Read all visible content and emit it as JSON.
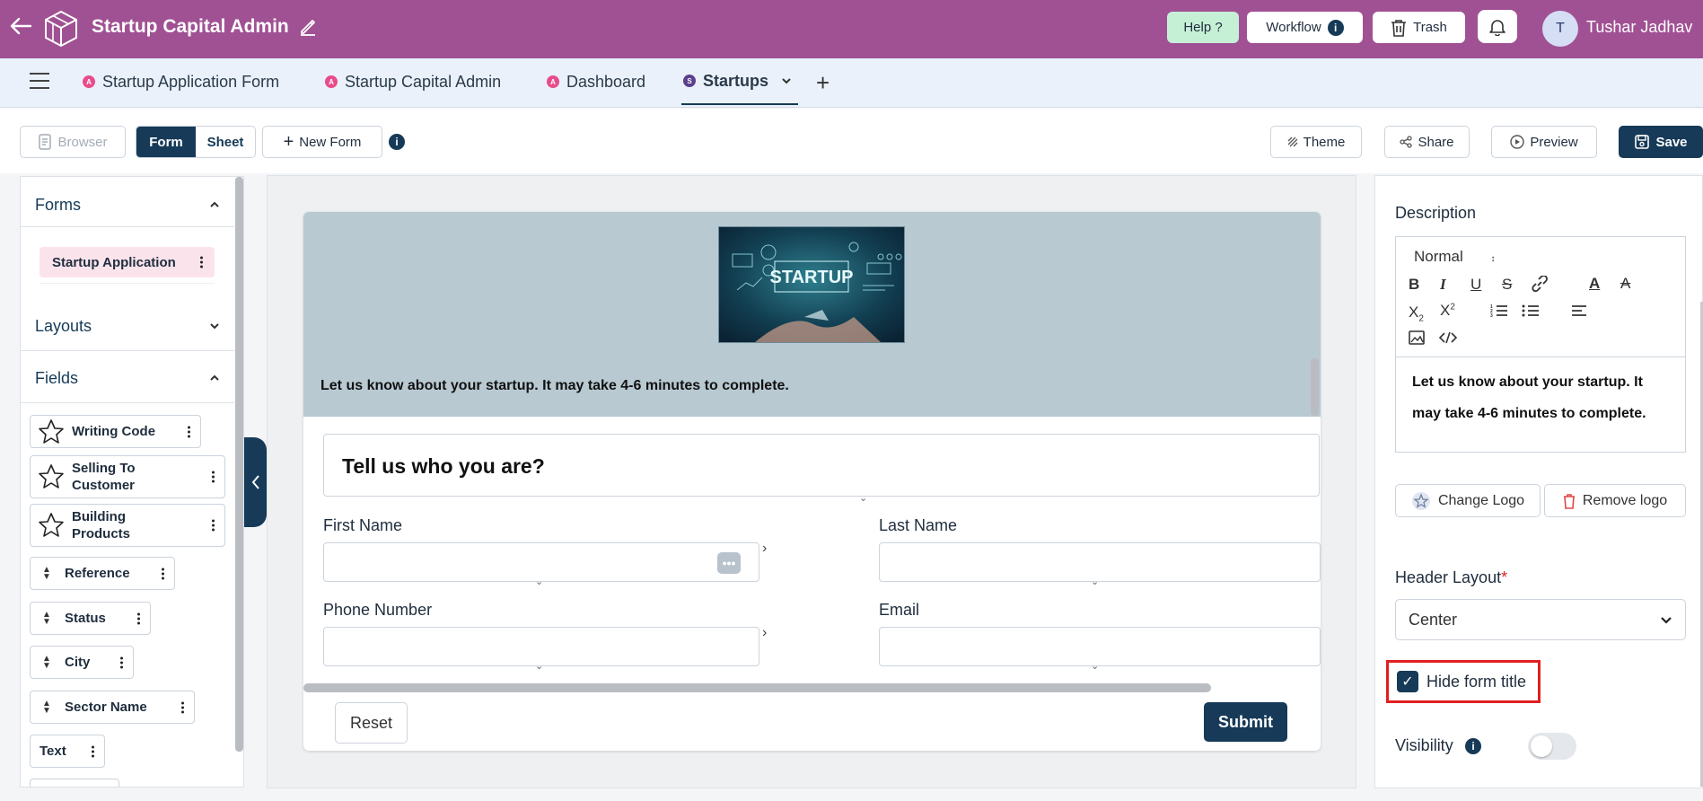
{
  "header": {
    "app_title": "Startup Capital Admin",
    "help_label": "Help ?",
    "workflow_label": "Workflow",
    "trash_label": "Trash",
    "user_initial": "T",
    "user_name": "Tushar Jadhav",
    "colors": {
      "brand": "#a05193",
      "accent": "#163a57"
    }
  },
  "tabs": [
    {
      "label": "Startup Application Form",
      "badge": "A"
    },
    {
      "label": "Startup Capital Admin",
      "badge": "A"
    },
    {
      "label": "Dashboard",
      "badge": "A"
    },
    {
      "label": "Startups",
      "badge": "S",
      "active": true
    }
  ],
  "toolbar": {
    "browser": "Browser",
    "form": "Form",
    "sheet": "Sheet",
    "new_form": "New Form",
    "theme": "Theme",
    "share": "Share",
    "preview": "Preview",
    "save": "Save"
  },
  "left_panel": {
    "forms_title": "Forms",
    "form_item": "Startup Application",
    "layouts_title": "Layouts",
    "fields_title": "Fields",
    "fields": [
      {
        "label": "Writing Code",
        "icon": "star-icon"
      },
      {
        "label": "Selling To Customer",
        "icon": "star-icon"
      },
      {
        "label": "Building Products",
        "icon": "star-icon"
      },
      {
        "label": "Reference",
        "icon": "updown-icon"
      },
      {
        "label": "Status",
        "icon": "updown-icon"
      },
      {
        "label": "City",
        "icon": "updown-icon"
      },
      {
        "label": "Sector Name",
        "icon": "updown-icon"
      },
      {
        "label": "Text",
        "icon": "none"
      }
    ]
  },
  "form": {
    "header_image_alt": "STARTUP",
    "header_text": "Let us know about your startup. It may take 4-6 minutes to complete.",
    "section_title": "Tell us who you are?",
    "first_name_label": "First Name",
    "last_name_label": "Last Name",
    "phone_label": "Phone Number",
    "email_label": "Email",
    "reset": "Reset",
    "submit": "Submit"
  },
  "right_panel": {
    "description_label": "Description",
    "editor_format": "Normal",
    "editor_content": "Let us know about your startup. It may take 4-6 minutes to complete.",
    "change_logo": "Change Logo",
    "remove_logo": "Remove logo",
    "header_layout_label": "Header Layout",
    "required_mark": "*",
    "header_layout_value": "Center",
    "hide_form_title_label": "Hide form title",
    "hide_form_title_checked": true,
    "visibility_label": "Visibility",
    "visibility_on": false
  }
}
